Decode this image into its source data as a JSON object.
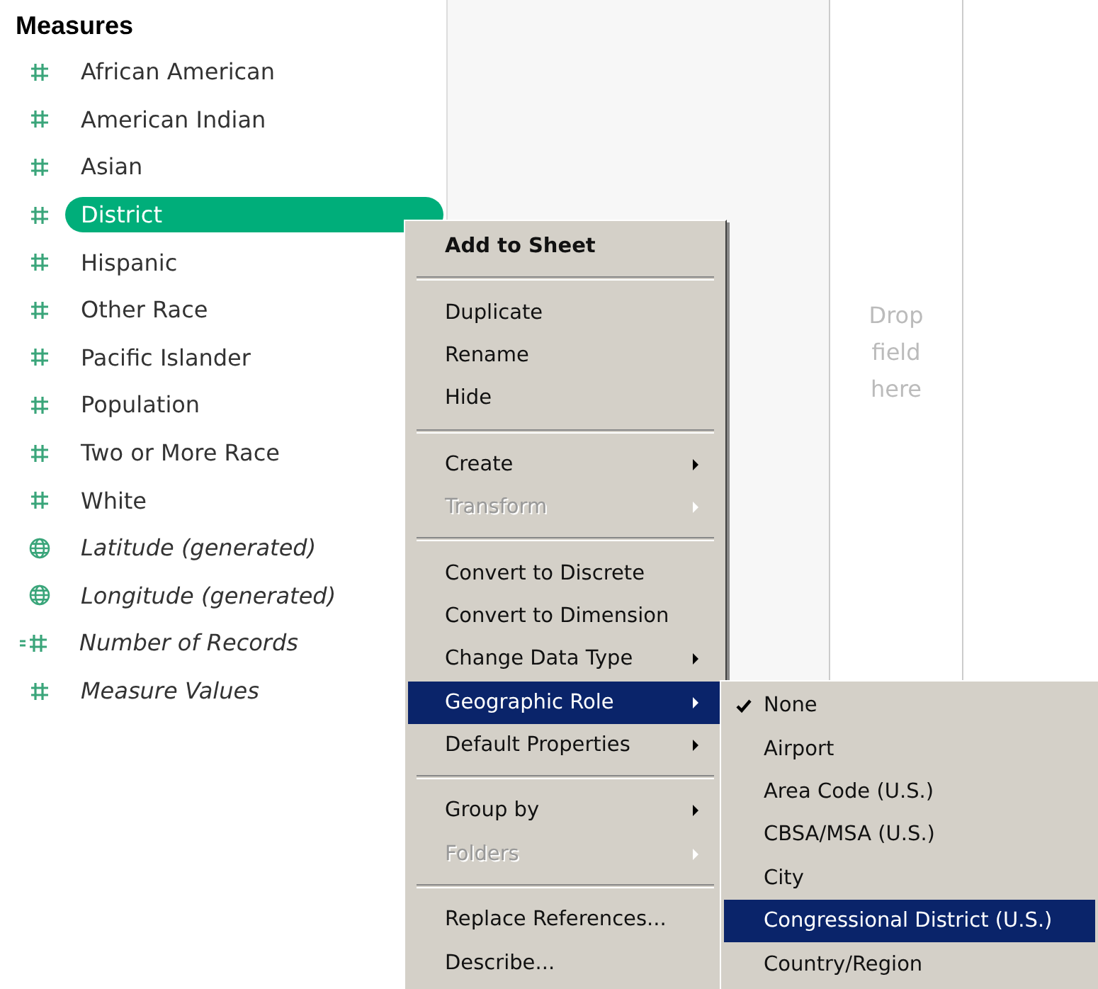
{
  "panel": {
    "title": "Measures"
  },
  "fields": [
    {
      "name": "African American",
      "kind": "measure",
      "italic": false,
      "selected": false
    },
    {
      "name": "American Indian",
      "kind": "measure",
      "italic": false,
      "selected": false
    },
    {
      "name": "Asian",
      "kind": "measure",
      "italic": false,
      "selected": false
    },
    {
      "name": "District",
      "kind": "measure",
      "italic": false,
      "selected": true
    },
    {
      "name": "Hispanic",
      "kind": "measure",
      "italic": false,
      "selected": false
    },
    {
      "name": "Other Race",
      "kind": "measure",
      "italic": false,
      "selected": false
    },
    {
      "name": "Pacific Islander",
      "kind": "measure",
      "italic": false,
      "selected": false
    },
    {
      "name": "Population",
      "kind": "measure",
      "italic": false,
      "selected": false
    },
    {
      "name": "Two or More Race",
      "kind": "measure",
      "italic": false,
      "selected": false
    },
    {
      "name": "White",
      "kind": "measure",
      "italic": false,
      "selected": false
    },
    {
      "name": "Latitude (generated)",
      "kind": "geo",
      "italic": true,
      "selected": false
    },
    {
      "name": "Longitude (generated)",
      "kind": "geo",
      "italic": true,
      "selected": false
    },
    {
      "name": "Number of Records",
      "kind": "calc",
      "italic": true,
      "selected": false
    },
    {
      "name": "Measure Values",
      "kind": "measure",
      "italic": true,
      "selected": false
    }
  ],
  "shelf": {
    "placeholder": "Drop field here"
  },
  "context_menu": [
    {
      "kind": "item",
      "label": "Add to Sheet",
      "bold": true,
      "disabled": false,
      "submenu": false,
      "selected": false
    },
    {
      "kind": "separator"
    },
    {
      "kind": "item",
      "label": "Duplicate",
      "bold": false,
      "disabled": false,
      "submenu": false,
      "selected": false
    },
    {
      "kind": "item",
      "label": "Rename",
      "bold": false,
      "disabled": false,
      "submenu": false,
      "selected": false
    },
    {
      "kind": "item",
      "label": "Hide",
      "bold": false,
      "disabled": false,
      "submenu": false,
      "selected": false
    },
    {
      "kind": "separator"
    },
    {
      "kind": "item",
      "label": "Create",
      "bold": false,
      "disabled": false,
      "submenu": true,
      "selected": false
    },
    {
      "kind": "item",
      "label": "Transform",
      "bold": false,
      "disabled": true,
      "submenu": true,
      "selected": false
    },
    {
      "kind": "separator"
    },
    {
      "kind": "item",
      "label": "Convert to Discrete",
      "bold": false,
      "disabled": false,
      "submenu": false,
      "selected": false
    },
    {
      "kind": "item",
      "label": "Convert to Dimension",
      "bold": false,
      "disabled": false,
      "submenu": false,
      "selected": false
    },
    {
      "kind": "item",
      "label": "Change Data Type",
      "bold": false,
      "disabled": false,
      "submenu": true,
      "selected": false
    },
    {
      "kind": "item",
      "label": "Geographic Role",
      "bold": false,
      "disabled": false,
      "submenu": true,
      "selected": true
    },
    {
      "kind": "item",
      "label": "Default Properties",
      "bold": false,
      "disabled": false,
      "submenu": true,
      "selected": false
    },
    {
      "kind": "separator"
    },
    {
      "kind": "item",
      "label": "Group by",
      "bold": false,
      "disabled": false,
      "submenu": true,
      "selected": false
    },
    {
      "kind": "item",
      "label": "Folders",
      "bold": false,
      "disabled": true,
      "submenu": true,
      "selected": false
    },
    {
      "kind": "separator"
    },
    {
      "kind": "item",
      "label": "Replace References...",
      "bold": false,
      "disabled": false,
      "submenu": false,
      "selected": false
    },
    {
      "kind": "item",
      "label": "Describe...",
      "bold": false,
      "disabled": false,
      "submenu": false,
      "selected": false
    }
  ],
  "submenu": [
    {
      "label": "None",
      "checked": true,
      "selected": false
    },
    {
      "label": "Airport",
      "checked": false,
      "selected": false
    },
    {
      "label": "Area Code (U.S.)",
      "checked": false,
      "selected": false
    },
    {
      "label": "CBSA/MSA (U.S.)",
      "checked": false,
      "selected": false
    },
    {
      "label": "City",
      "checked": false,
      "selected": false
    },
    {
      "label": "Congressional District (U.S.)",
      "checked": false,
      "selected": true
    },
    {
      "label": "Country/Region",
      "checked": false,
      "selected": false
    }
  ]
}
